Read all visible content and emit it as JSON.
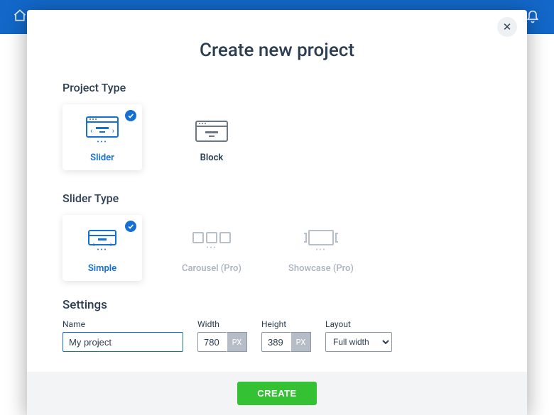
{
  "modal": {
    "title": "Create new project",
    "close_label": "✕"
  },
  "sections": {
    "project_type": {
      "title": "Project Type",
      "options": [
        {
          "id": "slider",
          "label": "Slider",
          "selected": true
        },
        {
          "id": "block",
          "label": "Block",
          "selected": false
        }
      ]
    },
    "slider_type": {
      "title": "Slider Type",
      "options": [
        {
          "id": "simple",
          "label": "Simple",
          "selected": true,
          "disabled": false
        },
        {
          "id": "carousel",
          "label": "Carousel (Pro)",
          "selected": false,
          "disabled": true
        },
        {
          "id": "showcase",
          "label": "Showcase (Pro)",
          "selected": false,
          "disabled": true
        }
      ]
    },
    "settings": {
      "title": "Settings",
      "name": {
        "label": "Name",
        "value": "My project"
      },
      "width": {
        "label": "Width",
        "value": "780",
        "unit": "PX"
      },
      "height": {
        "label": "Height",
        "value": "389",
        "unit": "PX"
      },
      "layout": {
        "label": "Layout",
        "value": "Full width"
      }
    }
  },
  "footer": {
    "create_label": "CREATE"
  },
  "topbar": {}
}
